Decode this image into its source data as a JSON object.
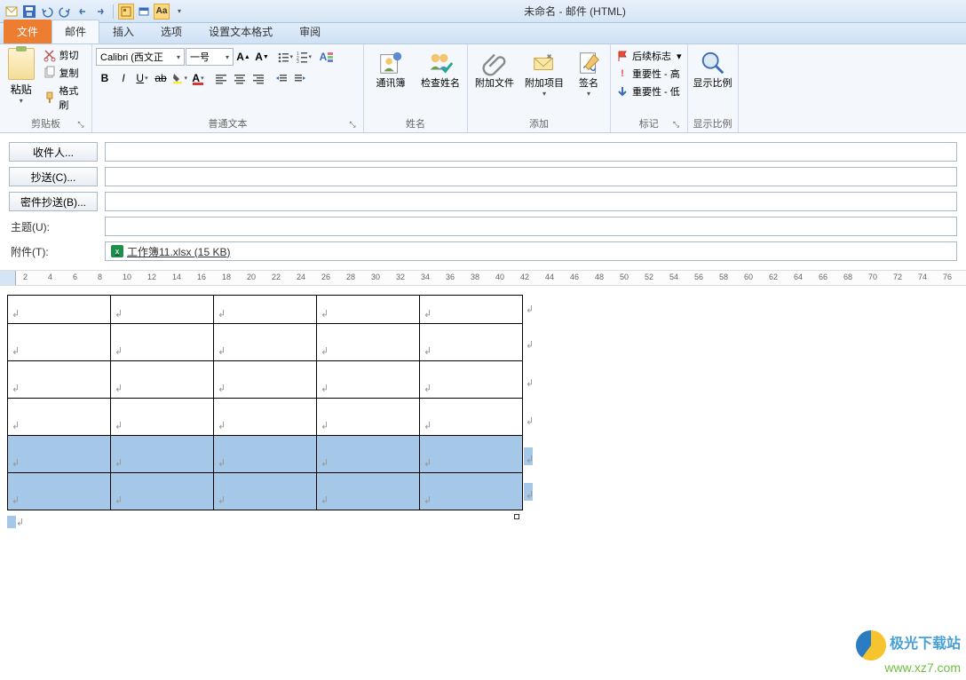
{
  "window_title": "未命名 - 邮件 (HTML)",
  "tabs": {
    "file": "文件",
    "mail": "邮件",
    "insert": "插入",
    "options": "选项",
    "format": "设置文本格式",
    "review": "审阅"
  },
  "clipboard": {
    "paste": "粘贴",
    "cut": "剪切",
    "copy": "复制",
    "painter": "格式刷",
    "group": "剪贴板"
  },
  "font": {
    "name": "Calibri (西文正",
    "size": "一号",
    "group": "普通文本"
  },
  "names": {
    "addressbook": "通讯簿",
    "checknames": "检查姓名",
    "group": "姓名"
  },
  "include": {
    "attachfile": "附加文件",
    "attachitem": "附加项目",
    "signature": "签名",
    "group": "添加"
  },
  "tags": {
    "followup": "后续标志",
    "high": "重要性 - 高",
    "low": "重要性 - 低",
    "group": "标记"
  },
  "zoom": {
    "label": "显示比例",
    "group": "显示比例"
  },
  "fields": {
    "to": "收件人...",
    "cc": "抄送(C)...",
    "bcc": "密件抄送(B)...",
    "subject": "主题(U):",
    "attach": "附件(T):",
    "attach_value": "工作簿11.xlsx (15 KB)"
  },
  "ruler_numbers": [
    2,
    4,
    6,
    8,
    10,
    12,
    14,
    16,
    18,
    20,
    22,
    24,
    26,
    28,
    30,
    32,
    34,
    36,
    38,
    40,
    42,
    44,
    46,
    48,
    50,
    52,
    54,
    56,
    58,
    60,
    62,
    64,
    66,
    68,
    70,
    72,
    74,
    76
  ],
  "watermark": {
    "t1": "极光下载站",
    "t2": "www.xz7.com"
  }
}
